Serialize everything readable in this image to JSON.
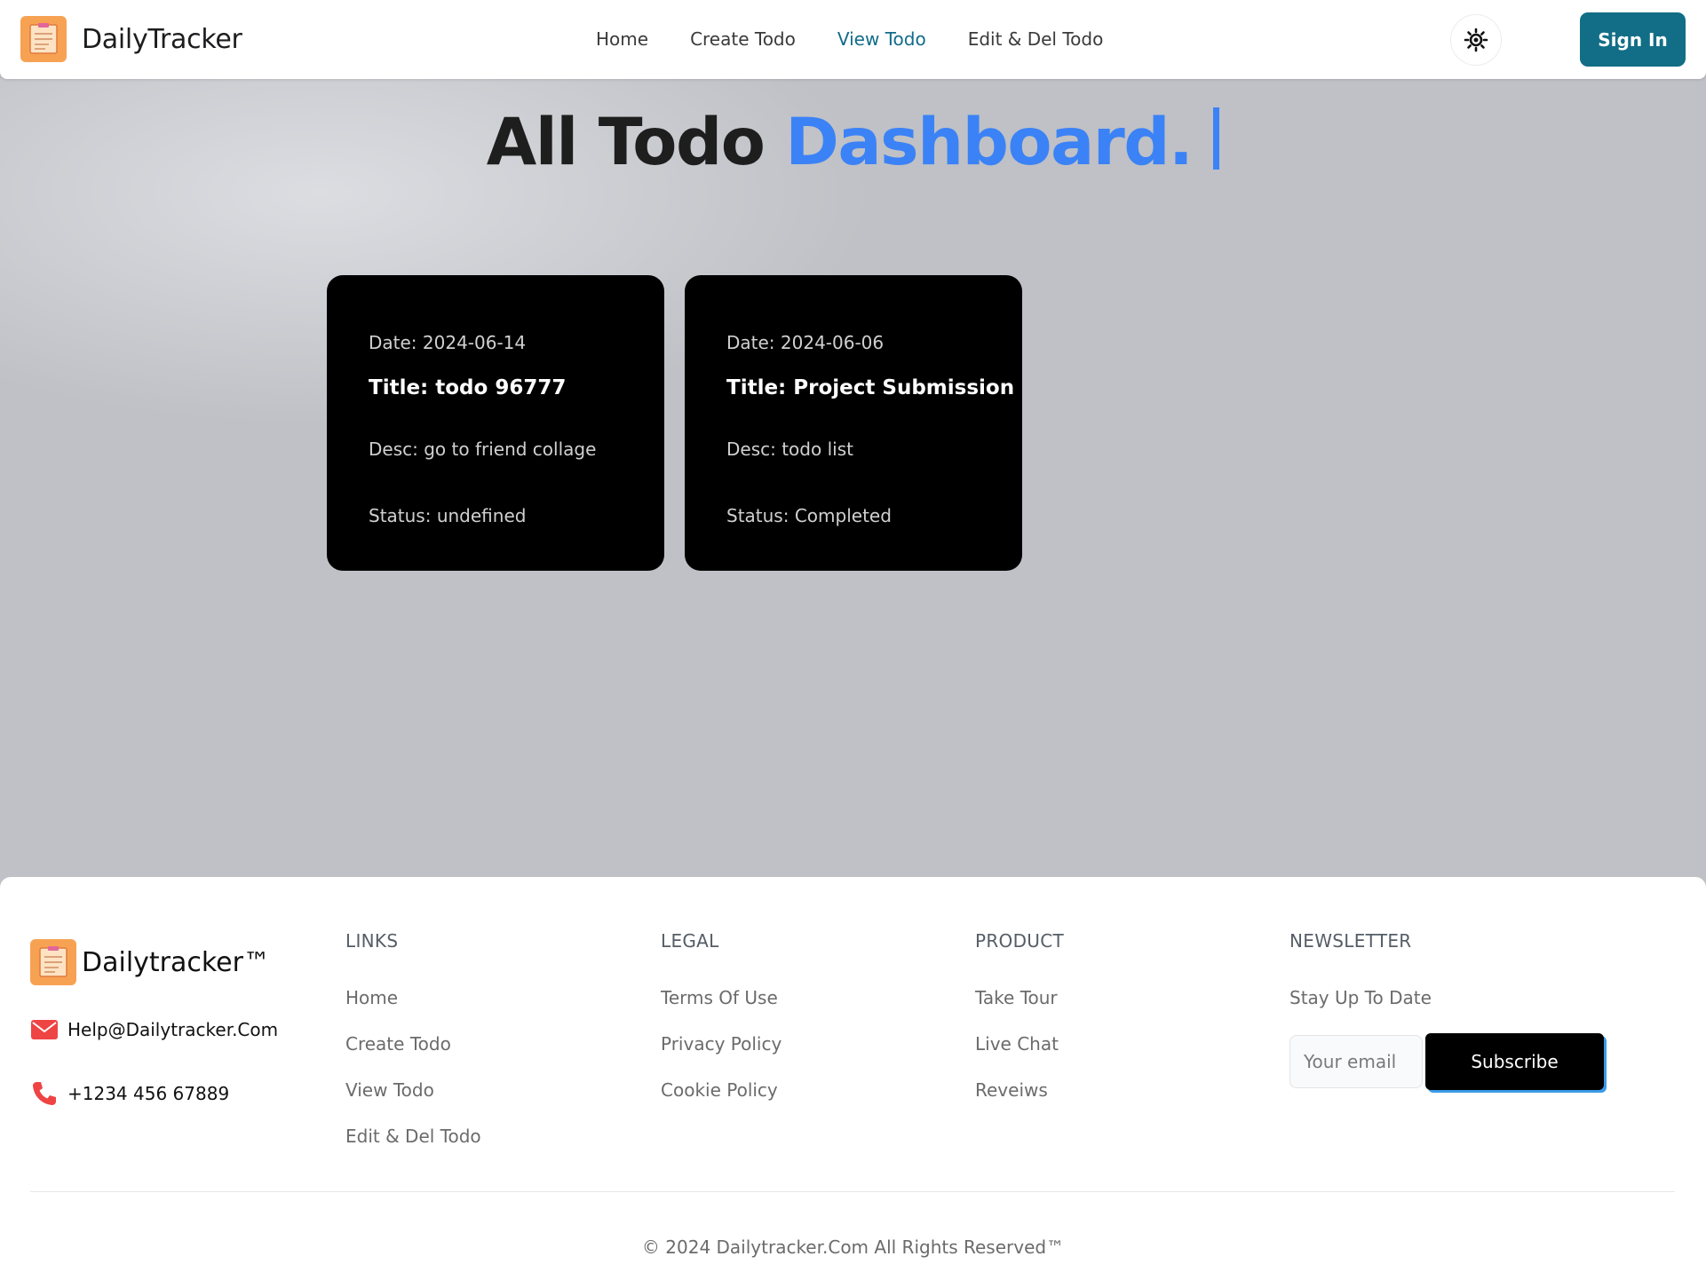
{
  "navbar": {
    "brand": "DailyTracker",
    "links": [
      "Home",
      "Create Todo",
      "View Todo",
      "Edit & Del Todo"
    ],
    "active_link": "View Todo",
    "signin_label": "Sign In",
    "theme_icon": "sun-icon"
  },
  "heading": {
    "part1": "All Todo",
    "part2": "Dashboard."
  },
  "todos": [
    {
      "date": "Date: 2024-06-14",
      "title": "Title: todo 96777",
      "desc": "Desc: go to friend collage",
      "status": "Status: undefined"
    },
    {
      "date": "Date: 2024-06-06",
      "title": "Title: Project Submission",
      "desc": "Desc: todo list",
      "status": "Status: Completed"
    }
  ],
  "footer": {
    "brand": "Dailytracker™",
    "email": "Help@Dailytracker.Com",
    "phone": "+1234 456 67889",
    "columns": [
      {
        "heading": "LINKS",
        "items": [
          "Home",
          "Create Todo",
          "View Todo",
          "Edit & Del Todo"
        ]
      },
      {
        "heading": "LEGAL",
        "items": [
          "Terms Of Use",
          "Privacy Policy",
          "Cookie Policy"
        ]
      },
      {
        "heading": "PRODUCT",
        "items": [
          "Take Tour",
          "Live Chat",
          "Reveiws"
        ]
      }
    ],
    "newsletter": {
      "heading": "NEWSLETTER",
      "subtext": "Stay Up To Date",
      "placeholder": "Your email",
      "button": "Subscribe"
    },
    "copyright": "© 2024 Dailytracker.Com All Rights Reserved™"
  },
  "colors": {
    "accent_blue": "#3b82f6",
    "primary_teal": "#126e86",
    "logo_orange": "#f7a253",
    "card_bg": "#000000",
    "page_bg": "#bfc1c6"
  }
}
